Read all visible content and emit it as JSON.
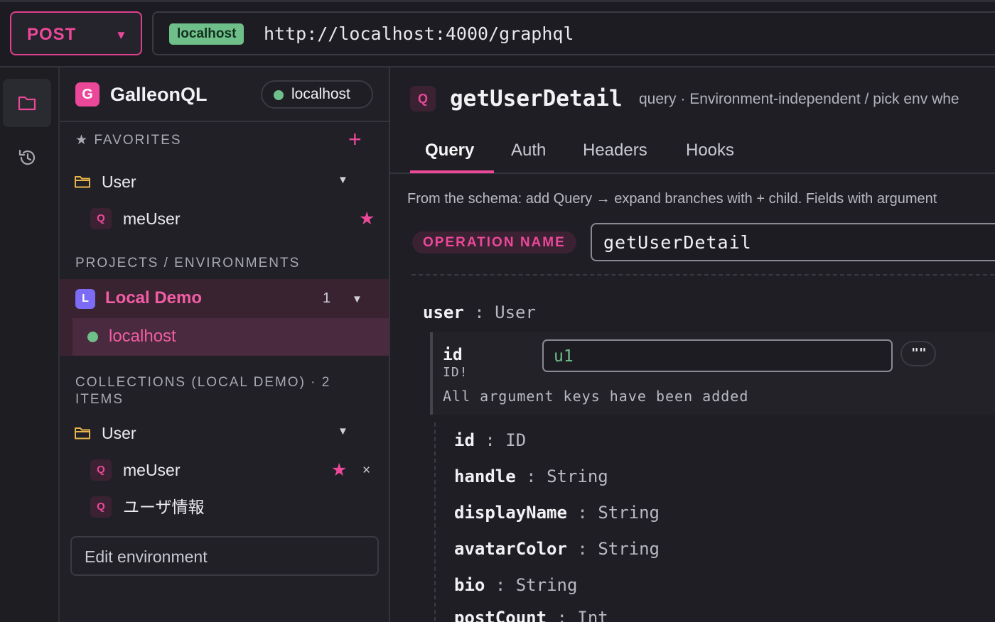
{
  "request": {
    "method": "POST",
    "env_tag": "localhost",
    "url": "http://localhost:4000/graphql"
  },
  "rail": {
    "items": [
      {
        "icon": "folder-icon",
        "active": true
      },
      {
        "icon": "history-icon",
        "active": false
      }
    ]
  },
  "sidebar": {
    "brand": {
      "logo_letter": "G",
      "name": "GalleonQL",
      "env_pill": "localhost"
    },
    "favorites": {
      "title": "FAVORITES",
      "folder": "User",
      "items": [
        {
          "badge": "Q",
          "label": "meUser",
          "starred": true
        }
      ]
    },
    "projects": {
      "title": "PROJECTS / ENVIRONMENTS",
      "project": {
        "badge": "L",
        "name": "Local Demo",
        "count": "1"
      },
      "environment": "localhost"
    },
    "collections": {
      "title_line1": "COLLECTIONS (LOCAL DEMO) · 2",
      "title_line2": "ITEMS",
      "folder": "User",
      "items": [
        {
          "badge": "Q",
          "label": "meUser",
          "starred": true,
          "close": "×"
        },
        {
          "badge": "Q",
          "label": "ユーザ情報"
        }
      ]
    },
    "edit_env_label": "Edit environment"
  },
  "main": {
    "badge": "Q",
    "title": "getUserDetail",
    "meta": "query · Environment-independent / pick env whe",
    "tabs": [
      {
        "label": "Query",
        "active": true
      },
      {
        "label": "Auth"
      },
      {
        "label": "Headers"
      },
      {
        "label": "Hooks"
      }
    ],
    "hint": "From the schema: add Query → expand branches with + child. Fields with argument",
    "operation_name_label": "OPERATION NAME",
    "operation_name_value": "getUserDetail",
    "root_field": {
      "name": "user",
      "sep": ":",
      "type": "User"
    },
    "argument": {
      "name": "id",
      "type": "ID!",
      "value": "u1",
      "quote_button": "\"\"",
      "note": "All argument keys have been added"
    },
    "child_fields": [
      {
        "name": "id",
        "type": "ID"
      },
      {
        "name": "handle",
        "type": "String"
      },
      {
        "name": "displayName",
        "type": "String"
      },
      {
        "name": "avatarColor",
        "type": "String"
      },
      {
        "name": "bio",
        "type": "String"
      },
      {
        "name": "postCount",
        "type": "Int"
      }
    ]
  },
  "colors": {
    "accent": "#ec4899",
    "success": "#6fbf8a",
    "project_badge": "#7c6cf5",
    "background": "#1e1e24"
  }
}
